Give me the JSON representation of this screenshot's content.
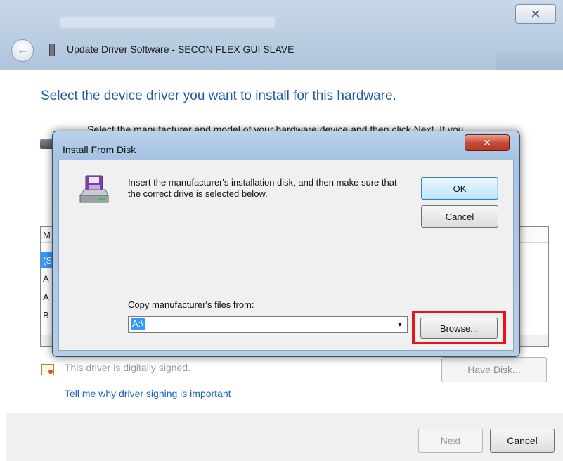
{
  "wizard": {
    "title": "Update Driver Software - SECON FLEX GUI SLAVE",
    "heading": "Select the device driver you want to install for this hardware.",
    "instruction": "Select the manufacturer and model of your hardware device and then click Next. If you",
    "list_partial_chars": [
      "M",
      "(S",
      "A",
      "A",
      "B"
    ],
    "signed_text": "This driver is digitally signed.",
    "signing_link": "Tell me why driver signing is important",
    "have_disk_label": "Have Disk...",
    "next_label": "Next",
    "cancel_label": "Cancel"
  },
  "dialog": {
    "title": "Install From Disk",
    "message": "Insert the manufacturer's installation disk, and then make sure that the correct drive is selected below.",
    "ok_label": "OK",
    "cancel_label": "Cancel",
    "copy_label": "Copy manufacturer's files from:",
    "path_value": "A:\\",
    "browse_label": "Browse..."
  },
  "icons": {
    "back": "back-arrow-icon",
    "device": "device-icon",
    "disk": "floppy-disk-icon",
    "certificate": "certificate-icon",
    "close": "close-icon",
    "dropdown": "chevron-down-icon"
  },
  "colors": {
    "heading_blue": "#1e5aa8",
    "link_blue": "#1a5fc1",
    "selection_blue": "#3399ff",
    "highlight_red": "#e8141b",
    "close_red": "#c74a35"
  }
}
